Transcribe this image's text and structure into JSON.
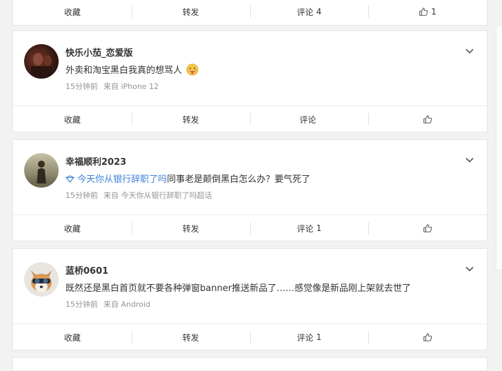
{
  "actions_common": {
    "favorite": "收藏",
    "repost": "转发",
    "comment": "评论"
  },
  "top_card": {
    "comment_count": "4",
    "like_count": "1"
  },
  "posts": [
    {
      "username": "快乐小茄_恋爱版",
      "content": "外卖和淘宝黑白我真的想骂人",
      "emoji": "tongue-out-emoji",
      "time": "15分钟前",
      "source": "来自 iPhone 12",
      "comment_count": "",
      "like_count": ""
    },
    {
      "username": "幸福顺利2023",
      "topic": "今天你从银行辞职了吗",
      "content": "同事老是颠倒黑白怎么办？要气死了",
      "time": "15分钟前",
      "source": "来自 今天你从银行辞职了吗超话",
      "comment_count": "1",
      "like_count": ""
    },
    {
      "username": "蓝桥0601",
      "content": "既然还是黑白首页就不要各种弹窗banner推送新品了……感觉像是新品刚上架就去世了",
      "time": "15分钟前",
      "source": "来自 Android",
      "comment_count": "1",
      "like_count": ""
    }
  ]
}
